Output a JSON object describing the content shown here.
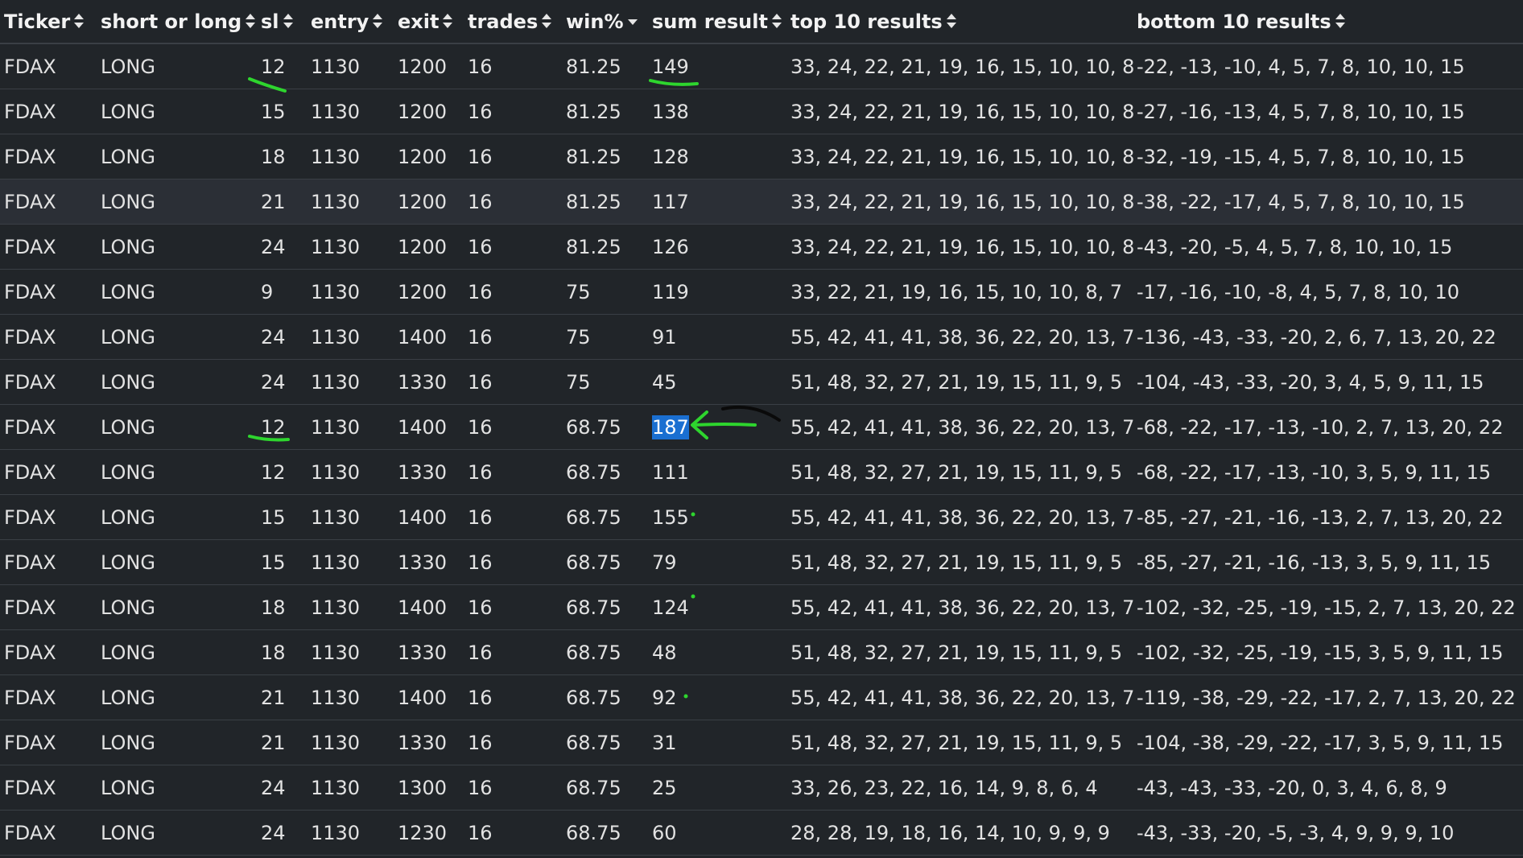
{
  "columns": [
    {
      "label": "Ticker",
      "sort": "none"
    },
    {
      "label": "short or long",
      "sort": "none"
    },
    {
      "label": "sl",
      "sort": "none"
    },
    {
      "label": "entry",
      "sort": "none"
    },
    {
      "label": "exit",
      "sort": "none"
    },
    {
      "label": "trades",
      "sort": "none"
    },
    {
      "label": "win%",
      "sort": "desc"
    },
    {
      "label": "sum result",
      "sort": "none"
    },
    {
      "label": "top 10 results",
      "sort": "none"
    },
    {
      "label": "bottom 10 results",
      "sort": "none"
    }
  ],
  "rows": [
    [
      "FDAX",
      "LONG",
      "12",
      "1130",
      "1200",
      "16",
      "81.25",
      "149",
      "33, 24, 22, 21, 19, 16, 15, 10, 10, 8",
      "-22, -13, -10, 4, 5, 7, 8, 10, 10, 15"
    ],
    [
      "FDAX",
      "LONG",
      "15",
      "1130",
      "1200",
      "16",
      "81.25",
      "138",
      "33, 24, 22, 21, 19, 16, 15, 10, 10, 8",
      "-27, -16, -13, 4, 5, 7, 8, 10, 10, 15"
    ],
    [
      "FDAX",
      "LONG",
      "18",
      "1130",
      "1200",
      "16",
      "81.25",
      "128",
      "33, 24, 22, 21, 19, 16, 15, 10, 10, 8",
      "-32, -19, -15, 4, 5, 7, 8, 10, 10, 15"
    ],
    [
      "FDAX",
      "LONG",
      "21",
      "1130",
      "1200",
      "16",
      "81.25",
      "117",
      "33, 24, 22, 21, 19, 16, 15, 10, 10, 8",
      "-38, -22, -17, 4, 5, 7, 8, 10, 10, 15"
    ],
    [
      "FDAX",
      "LONG",
      "24",
      "1130",
      "1200",
      "16",
      "81.25",
      "126",
      "33, 24, 22, 21, 19, 16, 15, 10, 10, 8",
      "-43, -20, -5, 4, 5, 7, 8, 10, 10, 15"
    ],
    [
      "FDAX",
      "LONG",
      "9",
      "1130",
      "1200",
      "16",
      "75",
      "119",
      "33, 22, 21, 19, 16, 15, 10, 10, 8, 7",
      "-17, -16, -10, -8, 4, 5, 7, 8, 10, 10"
    ],
    [
      "FDAX",
      "LONG",
      "24",
      "1130",
      "1400",
      "16",
      "75",
      "91",
      "55, 42, 41, 41, 38, 36, 22, 20, 13, 7",
      "-136, -43, -33, -20, 2, 6, 7, 13, 20, 22"
    ],
    [
      "FDAX",
      "LONG",
      "24",
      "1130",
      "1330",
      "16",
      "75",
      "45",
      "51, 48, 32, 27, 21, 19, 15, 11, 9, 5",
      "-104, -43, -33, -20, 3, 4, 5, 9, 11, 15"
    ],
    [
      "FDAX",
      "LONG",
      "12",
      "1130",
      "1400",
      "16",
      "68.75",
      "187",
      "55, 42, 41, 41, 38, 36, 22, 20, 13, 7",
      "-68, -22, -17, -13, -10, 2, 7, 13, 20, 22"
    ],
    [
      "FDAX",
      "LONG",
      "12",
      "1130",
      "1330",
      "16",
      "68.75",
      "111",
      "51, 48, 32, 27, 21, 19, 15, 11, 9, 5",
      "-68, -22, -17, -13, -10, 3, 5, 9, 11, 15"
    ],
    [
      "FDAX",
      "LONG",
      "15",
      "1130",
      "1400",
      "16",
      "68.75",
      "155",
      "55, 42, 41, 41, 38, 36, 22, 20, 13, 7",
      "-85, -27, -21, -16, -13, 2, 7, 13, 20, 22"
    ],
    [
      "FDAX",
      "LONG",
      "15",
      "1130",
      "1330",
      "16",
      "68.75",
      "79",
      "51, 48, 32, 27, 21, 19, 15, 11, 9, 5",
      "-85, -27, -21, -16, -13, 3, 5, 9, 11, 15"
    ],
    [
      "FDAX",
      "LONG",
      "18",
      "1130",
      "1400",
      "16",
      "68.75",
      "124",
      "55, 42, 41, 41, 38, 36, 22, 20, 13, 7",
      "-102, -32, -25, -19, -15, 2, 7, 13, 20, 22"
    ],
    [
      "FDAX",
      "LONG",
      "18",
      "1130",
      "1330",
      "16",
      "68.75",
      "48",
      "51, 48, 32, 27, 21, 19, 15, 11, 9, 5",
      "-102, -32, -25, -19, -15, 3, 5, 9, 11, 15"
    ],
    [
      "FDAX",
      "LONG",
      "21",
      "1130",
      "1400",
      "16",
      "68.75",
      "92",
      "55, 42, 41, 41, 38, 36, 22, 20, 13, 7",
      "-119, -38, -29, -22, -17, 2, 7, 13, 20, 22"
    ],
    [
      "FDAX",
      "LONG",
      "21",
      "1130",
      "1330",
      "16",
      "68.75",
      "31",
      "51, 48, 32, 27, 21, 19, 15, 11, 9, 5",
      "-104, -38, -29, -22, -17, 3, 5, 9, 11, 15"
    ],
    [
      "FDAX",
      "LONG",
      "24",
      "1130",
      "1300",
      "16",
      "68.75",
      "25",
      "33, 26, 23, 22, 16, 14, 9, 8, 6, 4",
      "-43, -43, -33, -20, 0, 3, 4, 6, 8, 9"
    ],
    [
      "FDAX",
      "LONG",
      "24",
      "1130",
      "1230",
      "16",
      "68.75",
      "60",
      "28, 28, 19, 18, 16, 14, 10, 9, 9, 9",
      "-43, -33, -20, -5, -3, 4, 9, 9, 9, 10"
    ]
  ],
  "hover_row": 3,
  "selected_cell": {
    "row": 8,
    "col": 7
  },
  "colors": {
    "background": "#212529",
    "grid": "#3a3f45",
    "selection": "#1a6fd1",
    "annotation_green": "#2ed52e",
    "annotation_black": "#0a0a0a"
  },
  "icons": {
    "sort_none": "sort-updown-icon",
    "sort_desc": "sort-desc-icon"
  }
}
